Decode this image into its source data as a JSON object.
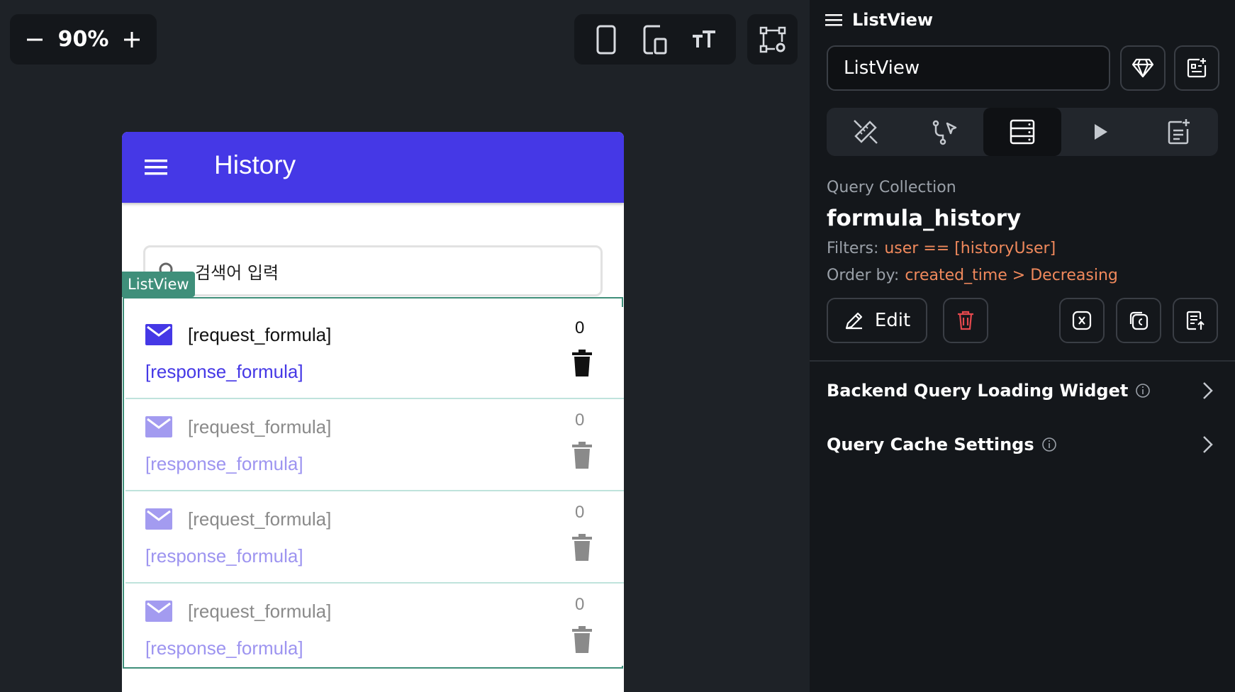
{
  "canvas": {
    "zoom": {
      "minus_label": "−",
      "value": "90%",
      "plus_label": "+"
    },
    "toolbar_icons": [
      "phone-icon",
      "tablet-icon",
      "text-size-icon",
      "layout-settings-icon"
    ]
  },
  "app": {
    "appbar_title": "History",
    "search_placeholder": "검색어 입력",
    "listview_tag": "ListView",
    "items": [
      {
        "request": "[request_formula]",
        "response": "[response_formula]",
        "count": "0"
      },
      {
        "request": "[request_formula]",
        "response": "[response_formula]",
        "count": "0"
      },
      {
        "request": "[request_formula]",
        "response": "[response_formula]",
        "count": "0"
      },
      {
        "request": "[request_formula]",
        "response": "[response_formula]",
        "count": "0"
      }
    ],
    "colors": {
      "appbar": "#4538e6",
      "listview_border": "#3f8f7a"
    }
  },
  "panel": {
    "header_title": "ListView",
    "name_value": "ListView",
    "query": {
      "label": "Query Collection",
      "collection": "formula_history",
      "filters_label": "Filters:",
      "filters_value": "user == [historyUser]",
      "order_label": "Order by:",
      "order_value": "created_time > Decreasing"
    },
    "edit_label": "Edit",
    "sections": {
      "loading_widget": "Backend Query Loading Widget",
      "cache_settings": "Query Cache Settings"
    },
    "colors": {
      "accent": "#f0895c",
      "delete": "#e5484d"
    }
  }
}
